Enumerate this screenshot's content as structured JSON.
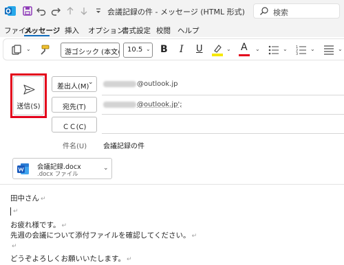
{
  "titlebar": {
    "title": "会議記録の件 - メッセージ (HTML 形式)",
    "search_placeholder": "検索",
    "icons": [
      "outlook-app-icon",
      "save-icon",
      "undo-icon",
      "redo-icon",
      "up-arrow-icon",
      "down-arrow-icon",
      "customize-qat-icon",
      "search-icon"
    ]
  },
  "menu": {
    "items": [
      "ファイル",
      "メッセージ",
      "挿入",
      "オプション",
      "書式設定",
      "校閲",
      "ヘルプ"
    ],
    "active": "メッセージ"
  },
  "ribbon": {
    "font_name": "游ゴシック (本文の",
    "font_size": "10.5",
    "bold": "B",
    "italic": "I",
    "underline": "U",
    "font_color_letter": "A",
    "highlight_color": "#f6e800",
    "font_color": "#e3001b"
  },
  "compose": {
    "send_label": "送信(S)",
    "from_label": "差出人(M)",
    "from_value": "@outlook.jp",
    "to_label": "宛先(T)",
    "to_value": "@outlook.jp';",
    "cc_label": "ＣＣ(C)",
    "subject_label": "件名(U)",
    "subject_value": "会議記録の件"
  },
  "attachment": {
    "name": "会議記録.docx",
    "type": ".docx ファイル"
  },
  "body": {
    "lines": [
      "田中さん",
      "",
      "お疲れ様です。",
      "先週の会議について添付ファイルを確認してください。",
      "",
      "どうぞよろしくお願いいたします。"
    ],
    "paragraph_mark": "↵"
  },
  "colors": {
    "accent": "#0f6cbd",
    "highlight_border": "#e3001b",
    "word_blue": "#185abd"
  }
}
